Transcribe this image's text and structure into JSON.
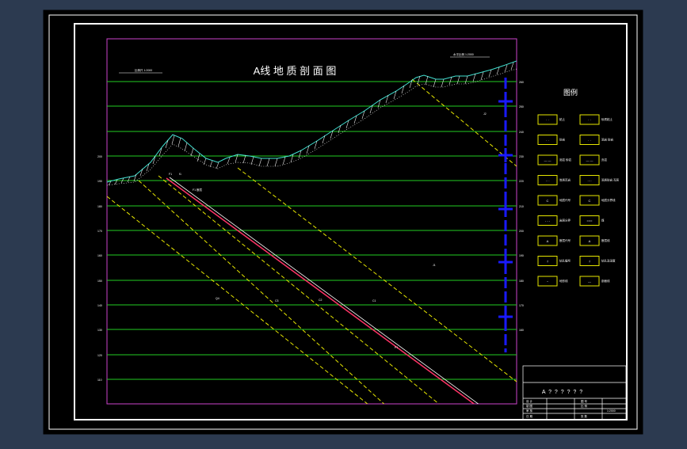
{
  "drawing": {
    "title": "A线 地 质 剖 面 图",
    "scale_note_left": "比例尺 1:2000",
    "scale_note_right": "水平比例 1:2000",
    "legend_title": "图例",
    "elevation_labels": [
      "260",
      "250",
      "240",
      "230",
      "220",
      "210",
      "200",
      "190",
      "180",
      "170",
      "160"
    ],
    "left_elevation_labels": [
      "200",
      "190",
      "180",
      "170",
      "160",
      "150",
      "140",
      "130",
      "120",
      "110"
    ],
    "layer_labels": [
      "Q4",
      "C3",
      "C2",
      "C1",
      "P1",
      "J1",
      "J2"
    ],
    "strata_label_1": "F1",
    "strata_label_2": "f1",
    "fault_label": "F1  断层",
    "legend_items": [
      {
        "icon": "· ·",
        "label": "粘土"
      },
      {
        "icon": "· ·",
        "label": "砂质粘土"
      },
      {
        "icon": "· ·",
        "label": "砂岩"
      },
      {
        "icon": "· ·",
        "label": "泥岩 砂岩"
      },
      {
        "icon": "— —",
        "label": "泥岩 砂岩"
      },
      {
        "icon": "— —",
        "label": "页岩"
      },
      {
        "icon": "·· ·",
        "label": "炭质页岩"
      },
      {
        "icon": "····",
        "label": "泥质砂岩 互层"
      },
      {
        "icon": "C",
        "label": "地层代号"
      },
      {
        "icon": "C",
        "label": "地层分界线"
      },
      {
        "icon": "- - -",
        "label": "岩层分界"
      },
      {
        "icon": "===",
        "label": "煤"
      },
      {
        "icon": "A",
        "label": "断层代号"
      },
      {
        "icon": "A",
        "label": "断层线"
      },
      {
        "icon": "f",
        "label": "钻孔编号"
      },
      {
        "icon": "f",
        "label": "钻孔及深度"
      },
      {
        "icon": "~",
        "label": "地形线"
      },
      {
        "icon": "—",
        "label": "剖面线"
      }
    ],
    "title_block": {
      "name": "A ? ? ? ? ? ?",
      "rows": [
        [
          "设 计",
          "",
          "",
          "图 号"
        ],
        [
          "制 图",
          "",
          "",
          "比 例"
        ],
        [
          "审 核",
          "",
          "",
          "1:2000"
        ],
        [
          "日 期",
          "",
          "",
          "张 数"
        ]
      ]
    }
  },
  "colors": {
    "background": "#2c3a50",
    "sheet": "#000000",
    "frame": "#ffffff",
    "plot_border": "#cc44cc",
    "grid": "#22cc22",
    "strata": "#e6e600",
    "terrain": "#40e0d0",
    "borehole": "#1a1aff",
    "fault": "#ff3366"
  }
}
